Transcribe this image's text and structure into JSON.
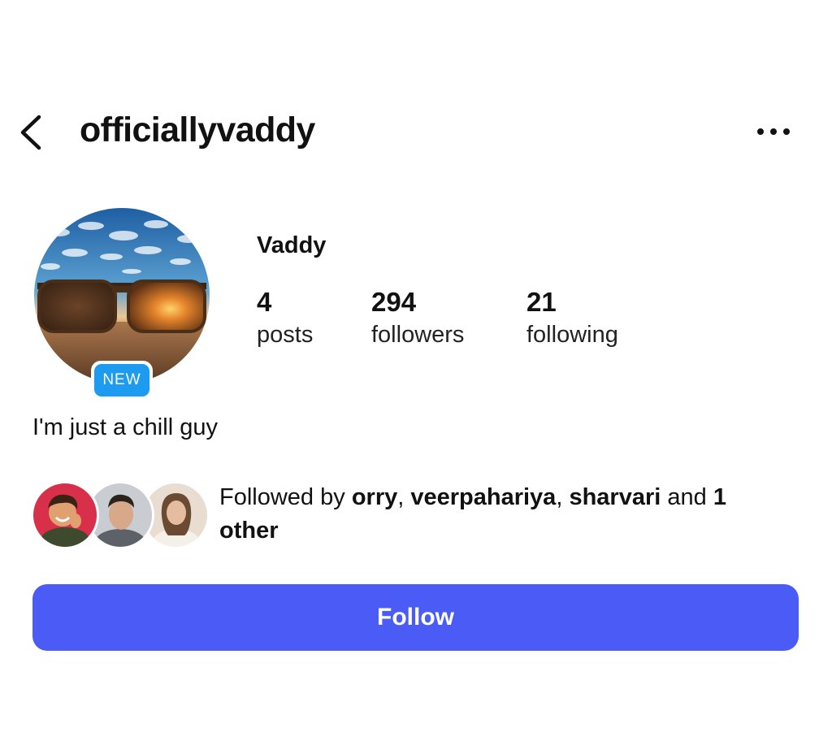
{
  "header": {
    "back_icon": "chevron-left-icon",
    "username": "officiallyvaddy",
    "more_icon": "ellipsis-horizontal-icon"
  },
  "profile": {
    "avatar_description": "sunglasses-on-beach-sunset",
    "badge": "NEW",
    "display_name": "Vaddy",
    "bio": "I'm just a chill guy"
  },
  "stats": [
    {
      "value": "4",
      "label": "posts"
    },
    {
      "value": "294",
      "label": "followers"
    },
    {
      "value": "21",
      "label": "following"
    }
  ],
  "followed_by": {
    "prefix": "Followed by ",
    "users": [
      "orry",
      "veerpahariya",
      "sharvari"
    ],
    "separator": ", ",
    "conjunction": " and ",
    "others_count": "1",
    "others_label": "other"
  },
  "follow_button": {
    "label": "Follow"
  },
  "colors": {
    "follow_button": "#4a5cf5",
    "badge": "#1c9bf0",
    "text": "#111111"
  }
}
